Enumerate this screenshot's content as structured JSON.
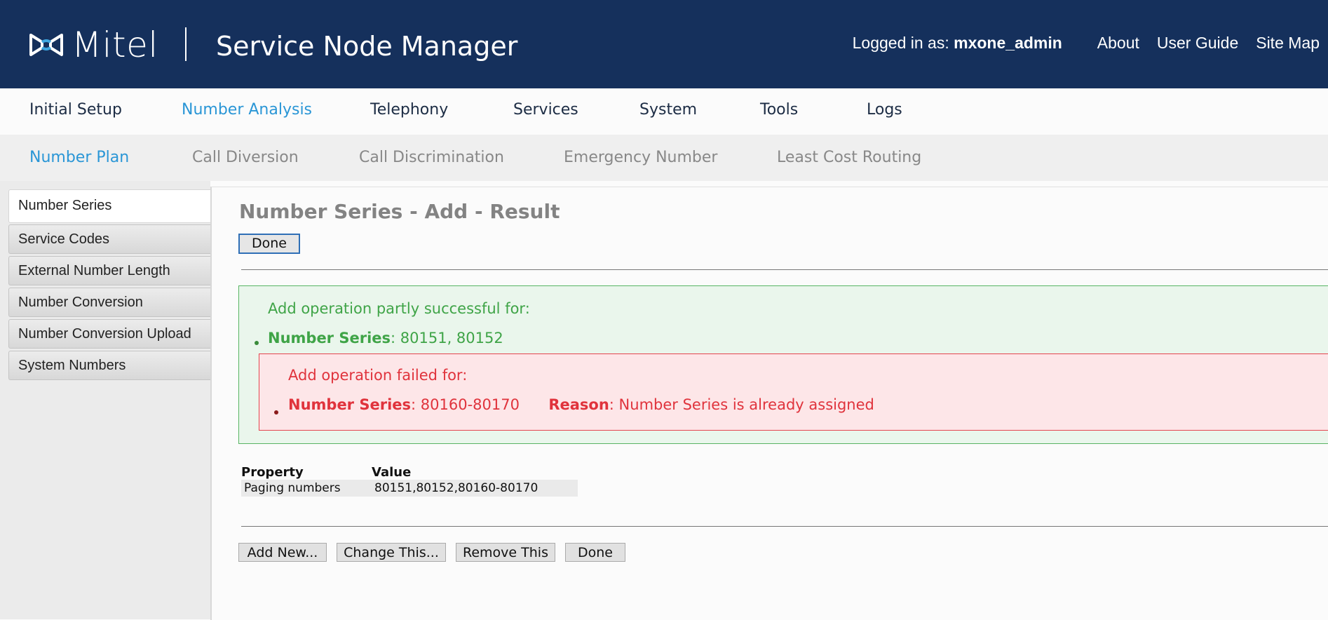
{
  "header": {
    "logo_text": "Mitel",
    "app_title": "Service Node Manager",
    "logged_in_label": "Logged in as:",
    "username": "mxone_admin",
    "links": [
      "About",
      "User Guide",
      "Site Map"
    ]
  },
  "main_nav": {
    "items": [
      "Initial Setup",
      "Number Analysis",
      "Telephony",
      "Services",
      "System",
      "Tools",
      "Logs"
    ],
    "active": "Number Analysis"
  },
  "sub_nav": {
    "items": [
      "Number Plan",
      "Call Diversion",
      "Call Discrimination",
      "Emergency Number",
      "Least Cost Routing"
    ],
    "active": "Number Plan"
  },
  "sidebar": {
    "items": [
      "Number Series",
      "Service Codes",
      "External Number Length",
      "Number Conversion",
      "Number Conversion Upload",
      "System Numbers"
    ],
    "active": "Number Series"
  },
  "content": {
    "title": "Number Series - Add - Result",
    "done_label": "Done",
    "success": {
      "heading": "Add operation partly successful for:",
      "label": "Number Series",
      "value": ": 80151, 80152"
    },
    "failure": {
      "heading": "Add operation failed for:",
      "label": "Number Series",
      "value": ": 80160-80170",
      "reason_label": "Reason",
      "reason_value": ": Number Series is already assigned"
    },
    "table": {
      "headers": [
        "Property",
        "Value"
      ],
      "rows": [
        [
          "Paging numbers",
          "80151,80152,80160-80170"
        ]
      ]
    },
    "actions": {
      "add_new": "Add New...",
      "change_this": "Change This...",
      "remove_this": "Remove This",
      "done": "Done"
    }
  },
  "colors": {
    "header_bg": "#15305c",
    "accent": "#2a96d6",
    "success": "#3fa447",
    "error": "#e0333c"
  }
}
